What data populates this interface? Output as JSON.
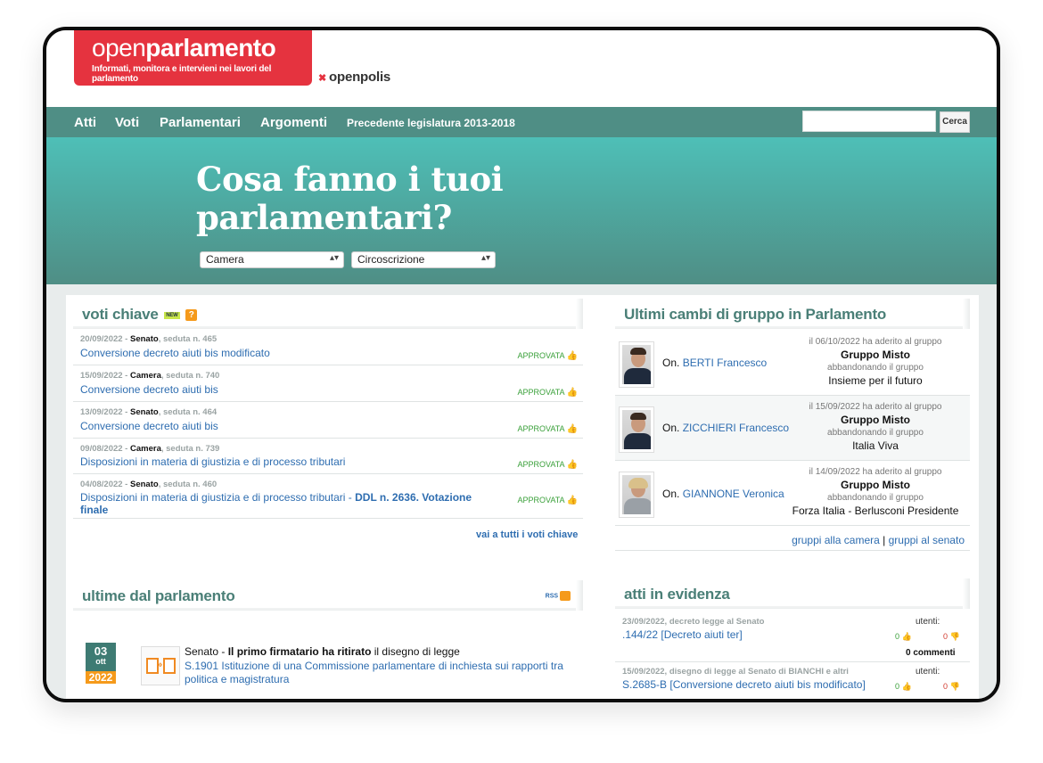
{
  "header": {
    "logo_light": "open",
    "logo_bold": "parlamento",
    "logo_tagline": "Informati, monitora e intervieni nei lavori del parlamento",
    "partner": "openpolis"
  },
  "nav": {
    "items": [
      "Atti",
      "Voti",
      "Parlamentari",
      "Argomenti"
    ],
    "legacy": "Precedente legislatura 2013-2018",
    "search_placeholder": "",
    "search_button": "Cerca"
  },
  "hero": {
    "title": "Cosa fanno i tuoi parlamentari?",
    "select_chamber": "Camera",
    "select_district": "Circoscrizione"
  },
  "key_votes": {
    "heading": "voti chiave",
    "new_badge": "NEW",
    "help_badge": "?",
    "items": [
      {
        "date": "20/09/2022",
        "chamber": "Senato",
        "session": "seduta n. 465",
        "title": "Conversione decreto aiuti bis modificato",
        "status": "APPROVATA"
      },
      {
        "date": "15/09/2022",
        "chamber": "Camera",
        "session": "seduta n. 740",
        "title": "Conversione decreto aiuti bis",
        "status": "APPROVATA"
      },
      {
        "date": "13/09/2022",
        "chamber": "Senato",
        "session": "seduta n. 464",
        "title": "Conversione decreto aiuti bis",
        "status": "APPROVATA"
      },
      {
        "date": "09/08/2022",
        "chamber": "Camera",
        "session": "seduta n. 739",
        "title": "Disposizioni in materia di giustizia e di processo tributari",
        "status": "APPROVATA"
      },
      {
        "date": "04/08/2022",
        "chamber": "Senato",
        "session": "seduta n. 460",
        "title": "Disposizioni in materia di giustizia e di processo tributari",
        "title_bold": "DDL n. 2636. Votazione finale",
        "status": "APPROVATA"
      }
    ],
    "all_link": "vai a tutti i voti chiave"
  },
  "group_changes": {
    "heading": "Ultimi cambi di gruppo in Parlamento",
    "items": [
      {
        "prefix": "On.",
        "name": "BERTI Francesco",
        "date_line": "il 06/10/2022 ha aderito al gruppo",
        "joined": "Gruppo Misto",
        "left_label": "abbandonando il gruppo",
        "left": "Insieme per il futuro"
      },
      {
        "prefix": "On.",
        "name": "ZICCHIERI Francesco",
        "date_line": "il 15/09/2022 ha aderito al gruppo",
        "joined": "Gruppo Misto",
        "left_label": "abbandonando il gruppo",
        "left": "Italia Viva"
      },
      {
        "prefix": "On.",
        "name": "GIANNONE Veronica",
        "date_line": "il 14/09/2022 ha aderito al gruppo",
        "joined": "Gruppo Misto",
        "left_label": "abbandonando il gruppo",
        "left": "Forza Italia - Berlusconi Presidente"
      }
    ],
    "link_camera": "gruppi alla camera",
    "separator": "|",
    "link_senato": "gruppi al senato"
  },
  "news": {
    "heading": "ultime dal parlamento",
    "rss": "RSS",
    "items": [
      {
        "day": "03",
        "month": "ott",
        "year": "2022",
        "chamber": "Senato",
        "dash": " - ",
        "action": "Il primo firmatario ha ritirato",
        "rest": " il disegno di legge",
        "title": "S.1901 Istituzione di una Commissione parlamentare di inchiesta sui rapporti tra politica e magistratura"
      }
    ]
  },
  "highlights": {
    "heading": "atti in evidenza",
    "items": [
      {
        "meta": "23/09/2022, decreto legge al Senato",
        "title": ".144/22 [Decreto aiuti ter]",
        "users_label": "utenti:",
        "plus": "0",
        "minus": "0",
        "comments": "0 commenti"
      },
      {
        "meta": "15/09/2022, disegno di legge al Senato di BIANCHI e altri",
        "title": "S.2685-B [Conversione decreto aiuti bis modificato]",
        "users_label": "utenti:",
        "plus": "0",
        "minus": "0",
        "comments": ""
      }
    ]
  },
  "colors": {
    "brand_red": "#e5333f",
    "teal": "#4f8e85",
    "link_blue": "#2e6db0",
    "approved_green": "#3aa03a",
    "orange": "#f59a1b"
  }
}
